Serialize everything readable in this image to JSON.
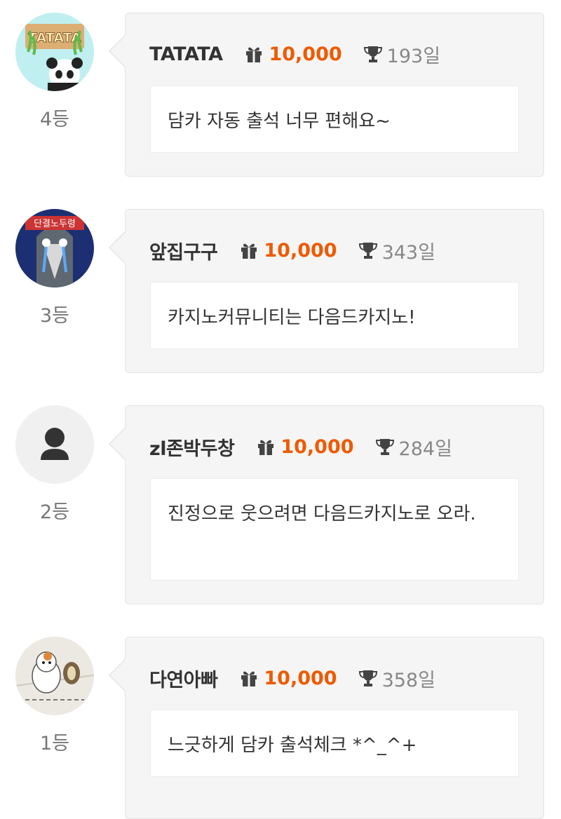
{
  "entries": [
    {
      "rank_label": "4등",
      "username": "TATATA",
      "points": "10,000",
      "days": "193일",
      "message": "담카 자동 출석 너무 편해요~",
      "avatar": "panda-sign-avatar",
      "avatar_text": "TATATA"
    },
    {
      "rank_label": "3등",
      "username": "앞집구구",
      "points": "10,000",
      "days": "343일",
      "message": "카지노커뮤니티는 다음드카지노!",
      "avatar": "crying-bird-avatar",
      "avatar_text": "단결노두령"
    },
    {
      "rank_label": "2등",
      "username": "zl존박두창",
      "points": "10,000",
      "days": "284일",
      "message": "진정으로 웃으려면 다음드카지노로 오라.",
      "avatar": "default-user-avatar",
      "avatar_text": ""
    },
    {
      "rank_label": "1등",
      "username": "다연아빠",
      "points": "10,000",
      "days": "358일",
      "message": "느긋하게 담카 출석체크 *^_^+",
      "avatar": "hamster-drum-avatar",
      "avatar_text": ""
    }
  ],
  "colors": {
    "points": "#ee5a00",
    "card_bg": "#f5f5f5",
    "muted": "#888888"
  }
}
